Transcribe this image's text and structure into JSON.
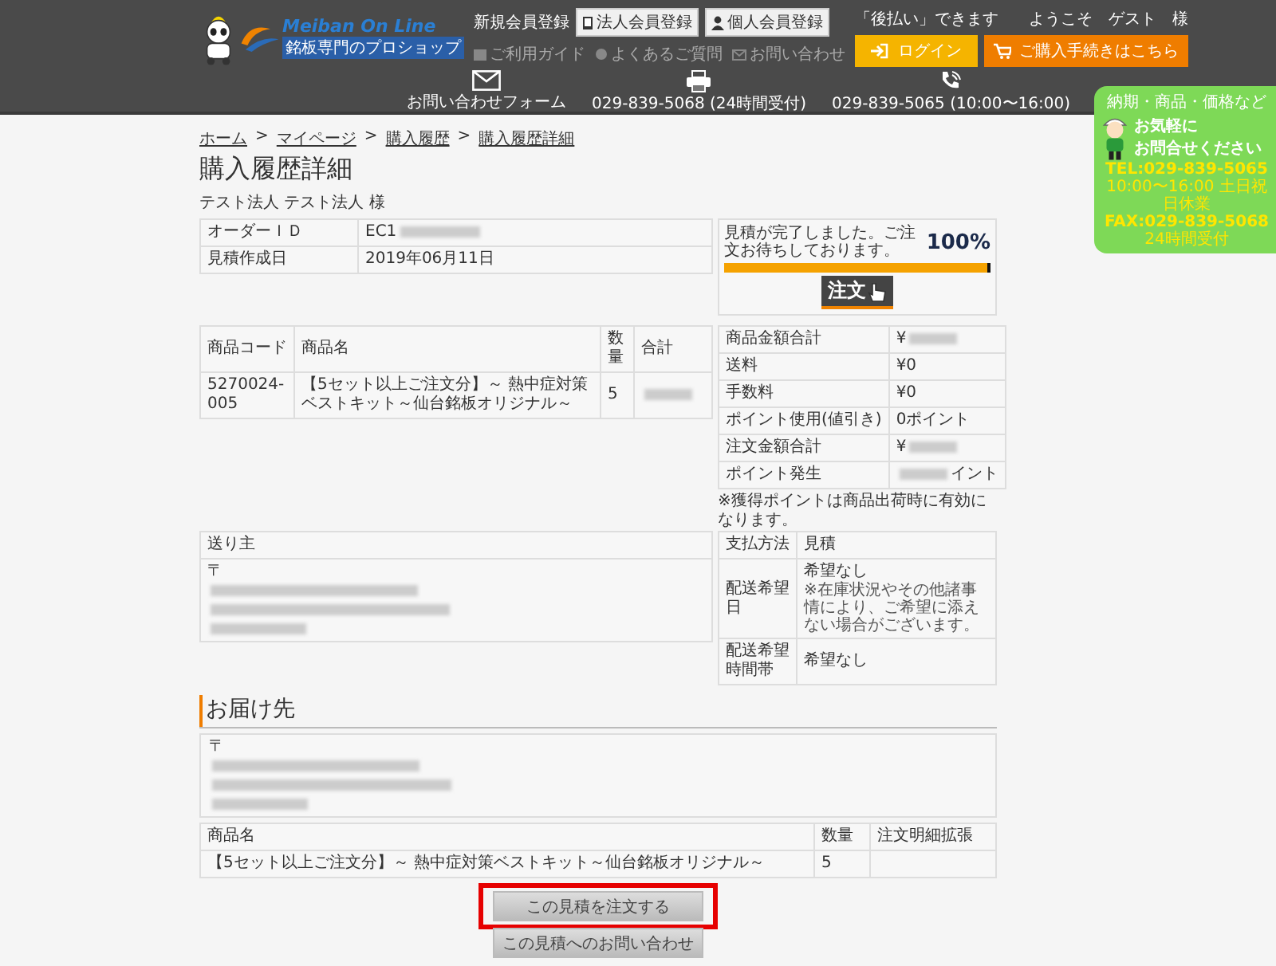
{
  "header": {
    "logo": {
      "brand": "Meiban On Line",
      "tagline": "銘板専門のプロショップ"
    },
    "signup_label": "新規会員登録",
    "signup_buttons": [
      {
        "kind": "corporate",
        "label": "法人会員登録"
      },
      {
        "kind": "personal",
        "label": "個人会員登録"
      }
    ],
    "links": [
      {
        "kind": "guide",
        "label": "ご利用ガイド"
      },
      {
        "kind": "faq",
        "label": "よくあるご質問"
      },
      {
        "kind": "contact",
        "label": "お問い合わせ"
      }
    ],
    "notice": "「後払い」できます",
    "welcome": "ようこそ　ゲスト　様",
    "login_button": "ログイン",
    "checkout_button": "ご購入手続きはこちら",
    "contacts": [
      {
        "kind": "mail",
        "label": "お問い合わせフォーム"
      },
      {
        "kind": "fax",
        "label": "029-839-5068 (24時間受付)"
      },
      {
        "kind": "phone",
        "label": "029-839-5065 (10:00〜16:00)"
      }
    ]
  },
  "side_banner": {
    "lead": "納期・商品・価格など",
    "title_lines": [
      "お気軽に",
      "お問合せください"
    ],
    "tel": "TEL:029-839-5065",
    "tel_hours": "10:00〜16:00 土日祝日休業",
    "fax": "FAX:029-839-5068",
    "fax_hours": "24時間受付"
  },
  "breadcrumb": {
    "separator": ">",
    "items": [
      "ホーム",
      "マイページ",
      "購入履歴",
      "購入履歴詳細"
    ]
  },
  "title": "購入履歴詳細",
  "customer": "テスト法人 テスト法人 様",
  "order_info": [
    {
      "label": "オーダーＩＤ",
      "value": "EC1",
      "blurred": true
    },
    {
      "label": "見積作成日",
      "value": "2019年06月11日"
    }
  ],
  "progress": {
    "message": "見積が完了しました。ご注文お待ちしております。",
    "percent": "100%",
    "level": 1,
    "button": "注文"
  },
  "items_table": {
    "columns": [
      "商品コード",
      "商品名",
      "数量",
      "合計"
    ],
    "rows": [
      {
        "code": "5270024-005",
        "name": "【5セット以上ご注文分】～ 熱中症対策ベストキット～仙台銘板オリジナル～",
        "qty": "5",
        "total_redacted": true
      }
    ]
  },
  "summary": [
    {
      "label": "商品金額合計",
      "value": "¥",
      "blurred": true
    },
    {
      "label": "送料",
      "value": "¥0"
    },
    {
      "label": "手数料",
      "value": "¥0"
    },
    {
      "label": "ポイント使用(値引き)",
      "value": "0ポイント"
    },
    {
      "label": "注文金額合計",
      "value": "¥",
      "blurred": true
    },
    {
      "label": "ポイント発生",
      "value": "イント",
      "blurred_prefix": true
    }
  ],
  "summary_note": "※獲得ポイントは商品出荷時に有効になります。",
  "sender": {
    "heading": "送り主",
    "postal_mark": "〒",
    "address_redacted": true
  },
  "shipping_info": [
    {
      "label": "支払方法",
      "value": "見積"
    },
    {
      "label": "配送希望日",
      "value": "希望なし",
      "note": "※在庫状況やその他諸事情により、ご希望に添えない場合がございます。"
    },
    {
      "label": "配送希望時間帯",
      "value": "希望なし"
    }
  ],
  "delivery": {
    "heading": "お届け先",
    "postal_mark": "〒",
    "address_redacted": true,
    "columns": [
      "商品名",
      "数量",
      "注文明細拡張"
    ],
    "rows": [
      {
        "name": "【5セット以上ご注文分】～ 熱中症対策ベストキット～仙台銘板オリジナル～",
        "qty": "5"
      }
    ]
  },
  "actions": [
    {
      "label": "この見積を注文する",
      "highlighted": true
    },
    {
      "label": "この見積へのお問い合わせ",
      "highlighted": false
    }
  ]
}
